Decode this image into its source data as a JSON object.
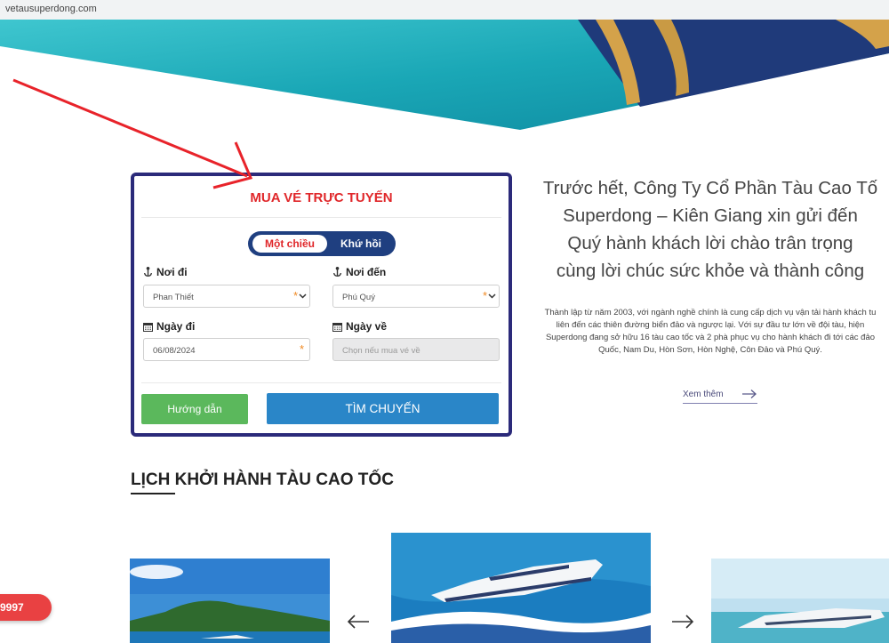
{
  "browser": {
    "url": "vetausuperdong.com"
  },
  "booking": {
    "title": "MUA VÉ TRỰC TUYẾN",
    "trip_types": {
      "one_way": "Một chiều",
      "round_trip": "Khứ hồi",
      "selected": "one_way"
    },
    "from_label": "Nơi đi",
    "from_value": "Phan Thiết",
    "to_label": "Nơi đến",
    "to_value": "Phú Quý",
    "depart_label": "Ngày đi",
    "depart_value": "06/08/2024",
    "return_label": "Ngày về",
    "return_placeholder": "Chọn nếu mua vé về",
    "required_mark": "*",
    "guide_button": "Hướng dẫn",
    "search_button": "TÌM CHUYẾN"
  },
  "intro": {
    "lines": [
      "Trước hết, Công Ty Cổ Phần Tàu Cao Tố",
      "Superdong – Kiên Giang xin gửi đến",
      "Quý hành khách lời chào trân trọng",
      "cùng lời chúc sức khỏe và thành công"
    ],
    "body_lines": [
      "Thành lập từ năm 2003, với ngành nghề chính là cung cấp dịch vụ vận tải hành khách tu",
      "liên đến các thiên đường biển đảo và ngược lại. Với sự đầu tư lớn về đội tàu, hiện",
      "Superdong đang sở hữu 16 tàu cao tốc và 2 phà phục vụ cho hành khách đi tới các đảo",
      "Quốc, Nam Du, Hòn Sơn, Hòn Nghệ, Côn Đảo và Phú Quý."
    ],
    "more_link": "Xem thêm"
  },
  "schedule": {
    "title": "LỊCH KHỞI HÀNH TÀU CAO TỐC"
  },
  "hotline": {
    "text": "9997"
  },
  "colors": {
    "brand_navy": "#2b2a7a",
    "accent_red": "#e0272a",
    "blue_button": "#2a86c8",
    "green_button": "#5bb85c"
  }
}
